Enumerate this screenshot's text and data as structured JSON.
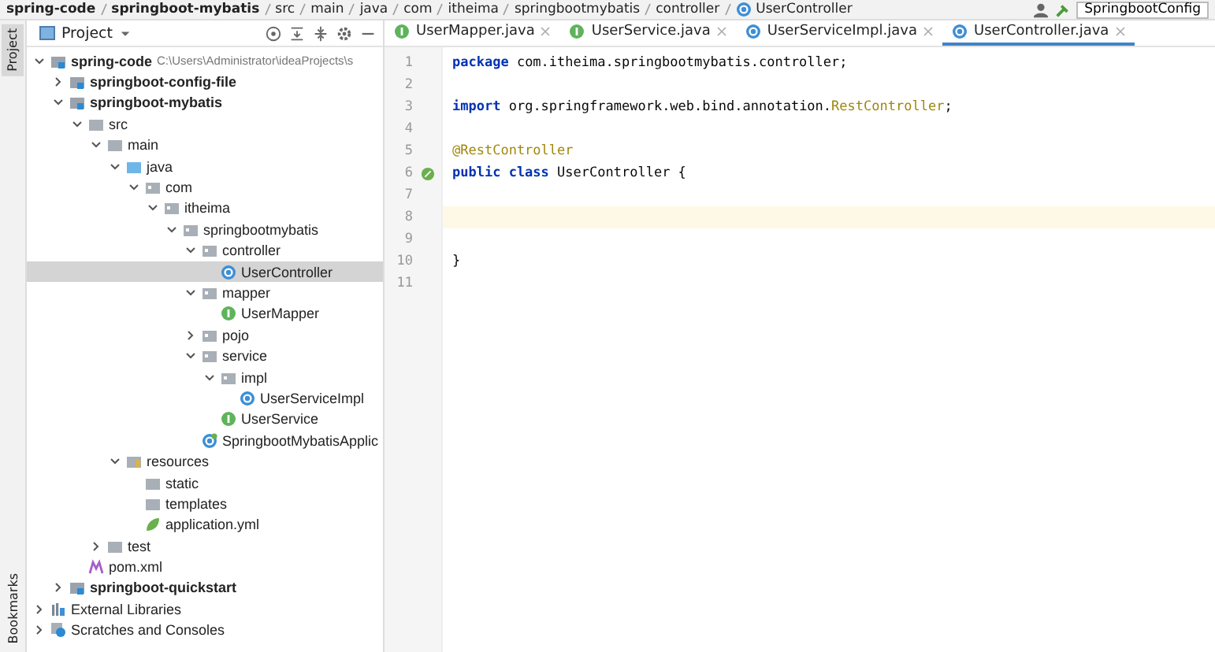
{
  "breadcrumb": [
    "spring-code",
    "springboot-mybatis",
    "src",
    "main",
    "java",
    "com",
    "itheima",
    "springbootmybatis",
    "controller",
    "UserController"
  ],
  "run_config": {
    "label": "SpringbootConfig"
  },
  "side_strip": {
    "top": "Project",
    "bottom": "Bookmarks"
  },
  "project_panel": {
    "title": "Project"
  },
  "tabs": [
    {
      "label": "UserMapper.java",
      "kind": "interface",
      "selected": false
    },
    {
      "label": "UserService.java",
      "kind": "interface",
      "selected": false
    },
    {
      "label": "UserServiceImpl.java",
      "kind": "class",
      "selected": false
    },
    {
      "label": "UserController.java",
      "kind": "class",
      "selected": true
    }
  ],
  "tree": [
    {
      "label": "spring-code",
      "hint": "C:\\Users\\Administrator\\ideaProjects\\s",
      "kind": "module",
      "bold": true,
      "expanded": true,
      "selected": false,
      "children": [
        {
          "label": "springboot-config-file",
          "kind": "module",
          "bold": true,
          "expanded": false,
          "selected": false
        },
        {
          "label": "springboot-mybatis",
          "kind": "module",
          "bold": true,
          "expanded": true,
          "selected": false,
          "children": [
            {
              "label": "src",
              "kind": "folder",
              "expanded": true,
              "selected": false,
              "children": [
                {
                  "label": "main",
                  "kind": "folder",
                  "expanded": true,
                  "selected": false,
                  "children": [
                    {
                      "label": "java",
                      "kind": "source-folder",
                      "expanded": true,
                      "selected": false,
                      "children": [
                        {
                          "label": "com",
                          "kind": "package",
                          "expanded": true,
                          "selected": false,
                          "children": [
                            {
                              "label": "itheima",
                              "kind": "package",
                              "expanded": true,
                              "selected": false,
                              "children": [
                                {
                                  "label": "springbootmybatis",
                                  "kind": "package",
                                  "expanded": true,
                                  "selected": false,
                                  "children": [
                                    {
                                      "label": "controller",
                                      "kind": "package",
                                      "expanded": true,
                                      "selected": false,
                                      "children": [
                                        {
                                          "label": "UserController",
                                          "kind": "class",
                                          "selected": true
                                        }
                                      ]
                                    },
                                    {
                                      "label": "mapper",
                                      "kind": "package",
                                      "expanded": true,
                                      "selected": false,
                                      "children": [
                                        {
                                          "label": "UserMapper",
                                          "kind": "interface",
                                          "selected": false
                                        }
                                      ]
                                    },
                                    {
                                      "label": "pojo",
                                      "kind": "package",
                                      "expanded": false,
                                      "selected": false
                                    },
                                    {
                                      "label": "service",
                                      "kind": "package",
                                      "expanded": true,
                                      "selected": false,
                                      "children": [
                                        {
                                          "label": "impl",
                                          "kind": "package",
                                          "expanded": true,
                                          "selected": false,
                                          "children": [
                                            {
                                              "label": "UserServiceImpl",
                                              "kind": "class",
                                              "selected": false
                                            }
                                          ]
                                        },
                                        {
                                          "label": "UserService",
                                          "kind": "interface",
                                          "selected": false
                                        }
                                      ]
                                    },
                                    {
                                      "label": "SpringbootMybatisApplic",
                                      "kind": "spring-class",
                                      "selected": false
                                    }
                                  ]
                                }
                              ]
                            }
                          ]
                        }
                      ]
                    },
                    {
                      "label": "resources",
                      "kind": "resources",
                      "expanded": true,
                      "selected": false,
                      "children": [
                        {
                          "label": "static",
                          "kind": "folder",
                          "selected": false
                        },
                        {
                          "label": "templates",
                          "kind": "folder",
                          "selected": false
                        },
                        {
                          "label": "application.yml",
                          "kind": "yml",
                          "selected": false
                        }
                      ]
                    }
                  ]
                },
                {
                  "label": "test",
                  "kind": "folder",
                  "expanded": false,
                  "selected": false
                }
              ]
            },
            {
              "label": "pom.xml",
              "kind": "maven",
              "selected": false
            }
          ]
        },
        {
          "label": "springboot-quickstart",
          "kind": "module",
          "bold": true,
          "expanded": false,
          "selected": false
        }
      ]
    },
    {
      "label": "External Libraries",
      "kind": "libraries",
      "expanded": false,
      "selected": false
    },
    {
      "label": "Scratches and Consoles",
      "kind": "scratches",
      "expanded": false,
      "selected": false
    }
  ],
  "editor": {
    "lines": [
      {
        "number": "1",
        "current": false,
        "tokens": [
          {
            "kind": "keyword",
            "text": "package"
          },
          {
            "kind": "plain",
            "text": " com.itheima.springbootmybatis.controller;"
          }
        ]
      },
      {
        "number": "2",
        "current": false
      },
      {
        "number": "3",
        "current": false,
        "tokens": [
          {
            "kind": "keyword",
            "text": "import"
          },
          {
            "kind": "plain",
            "text": " org.springframework.web.bind.annotation."
          },
          {
            "kind": "type",
            "text": "RestController"
          },
          {
            "kind": "plain",
            "text": ";"
          }
        ]
      },
      {
        "number": "4",
        "current": false
      },
      {
        "number": "5",
        "current": false,
        "tokens": [
          {
            "kind": "annotation",
            "text": "@RestController"
          }
        ]
      },
      {
        "number": "6",
        "current": false,
        "gutter_icon": true,
        "tokens": [
          {
            "kind": "keyword",
            "text": "public class"
          },
          {
            "kind": "plain",
            "text": " UserController {"
          }
        ]
      },
      {
        "number": "7",
        "current": false
      },
      {
        "number": "8",
        "current": true
      },
      {
        "number": "9",
        "current": false
      },
      {
        "number": "10",
        "current": false,
        "tokens": [
          {
            "kind": "plain",
            "text": "}"
          }
        ]
      },
      {
        "number": "11",
        "current": false
      }
    ]
  }
}
